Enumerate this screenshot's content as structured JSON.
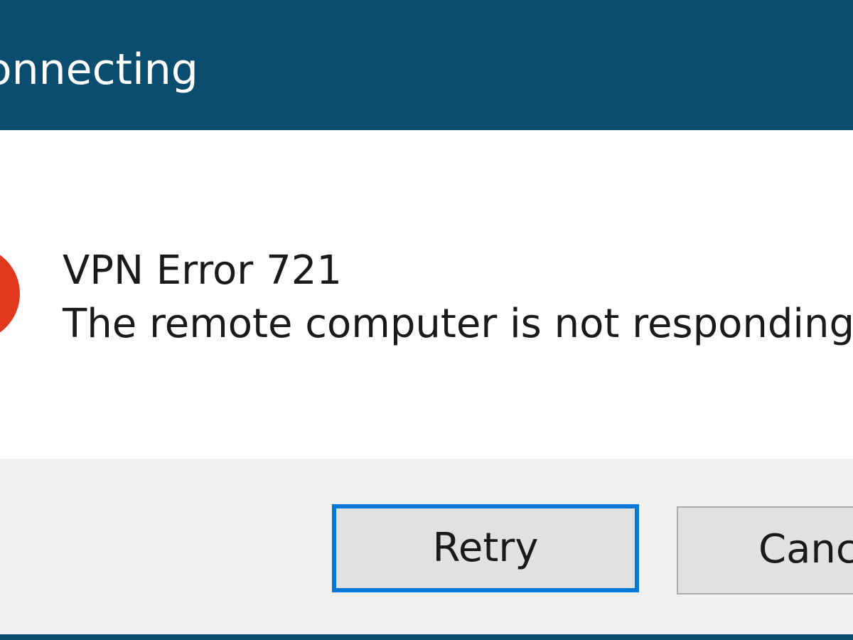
{
  "window": {
    "title": "Connecting"
  },
  "dialog": {
    "icon": "error-icon",
    "heading": "VPN Error 721",
    "message": "The remote computer is not responding"
  },
  "buttons": {
    "retry_label": "Retry",
    "cancel_label": "Cancel"
  },
  "colors": {
    "titlebar": "#0b4d6f",
    "error_icon": "#e0391d",
    "focus_border": "#0078d7",
    "footer": "#f0f0f0"
  }
}
